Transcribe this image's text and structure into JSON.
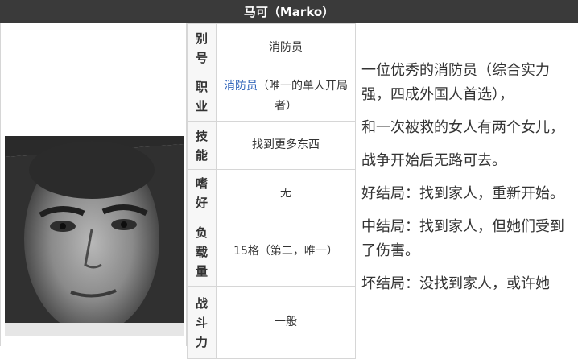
{
  "header": {
    "title": "马可（Marko）"
  },
  "attributes": [
    {
      "key": "别号",
      "value": "消防员"
    },
    {
      "key": "职业",
      "value_link": "消防员",
      "value_rest": "（唯一的单人开局者）"
    },
    {
      "key": "技能",
      "value": "找到更多东西"
    },
    {
      "key": "嗜好",
      "value": "无"
    },
    {
      "key": "负载量",
      "value": "15格（第二，唯一）"
    },
    {
      "key": "战斗力",
      "value": "一般"
    }
  ],
  "description": [
    "一位优秀的消防员（综合实力强，四成外国人首选），",
    "和一次被救的女人有两个女儿，",
    "战争开始后无路可去。",
    "好结局：找到家人，重新开始。",
    "中结局：找到家人，但她们受到了伤害。",
    "坏结局：没找到家人，或许她"
  ]
}
